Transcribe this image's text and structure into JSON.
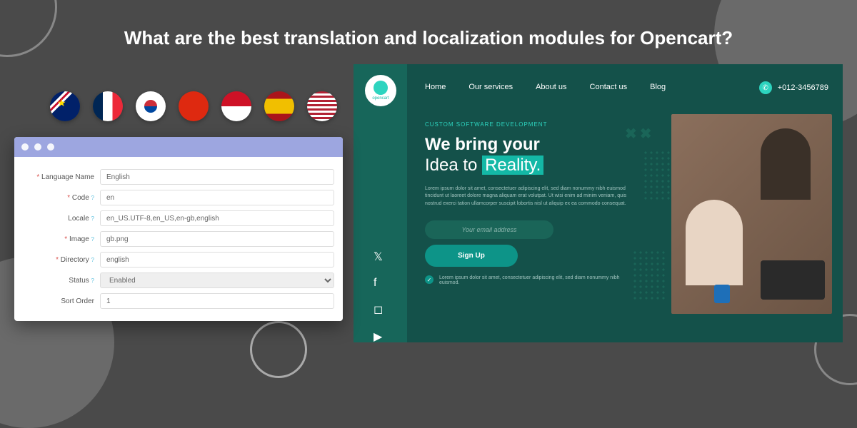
{
  "title": "What are the best translation and localization modules for Opencart?",
  "flags": [
    "uk",
    "fr",
    "kr",
    "cn",
    "id",
    "es",
    "us"
  ],
  "form": {
    "language_name": {
      "label": "Language Name",
      "value": "English",
      "required": true
    },
    "code": {
      "label": "Code",
      "value": "en",
      "required": true,
      "help": true
    },
    "locale": {
      "label": "Locale",
      "value": "en_US.UTF-8,en_US,en-gb,english",
      "help": true
    },
    "image": {
      "label": "Image",
      "value": "gb.png",
      "required": true,
      "help": true
    },
    "directory": {
      "label": "Directory",
      "value": "english",
      "required": true,
      "help": true
    },
    "status": {
      "label": "Status",
      "value": "Enabled",
      "help": true
    },
    "sort_order": {
      "label": "Sort Order",
      "value": "1"
    }
  },
  "website": {
    "logo_text": "opencart",
    "nav": [
      "Home",
      "Our services",
      "About us",
      "Contact us",
      "Blog"
    ],
    "phone": "+012-3456789",
    "subtitle": "CUSTOM SOFTWARE DEVELOPMENT",
    "hero_line1": "We bring your",
    "hero_line2a": "Idea to ",
    "hero_line2b": "Reality.",
    "lorem": "Lorem ipsum dolor sit amet, consectetuer adipiscing elit, sed diam nonummy nibh euismod tincidunt ut laoreet dolore magna aliquam erat volutpat. Ut wisi enim ad minim veniam, quis nostrud exerci tation ullamcorper suscipit lobortis nisl ut aliquip ex ea commodo consequat.",
    "email_placeholder": "Your email address",
    "signup": "Sign Up",
    "check_text": "Lorem ipsum dolor sit amet, consectetuer adipiscing elit, sed diam nonummy nibh euismod."
  }
}
